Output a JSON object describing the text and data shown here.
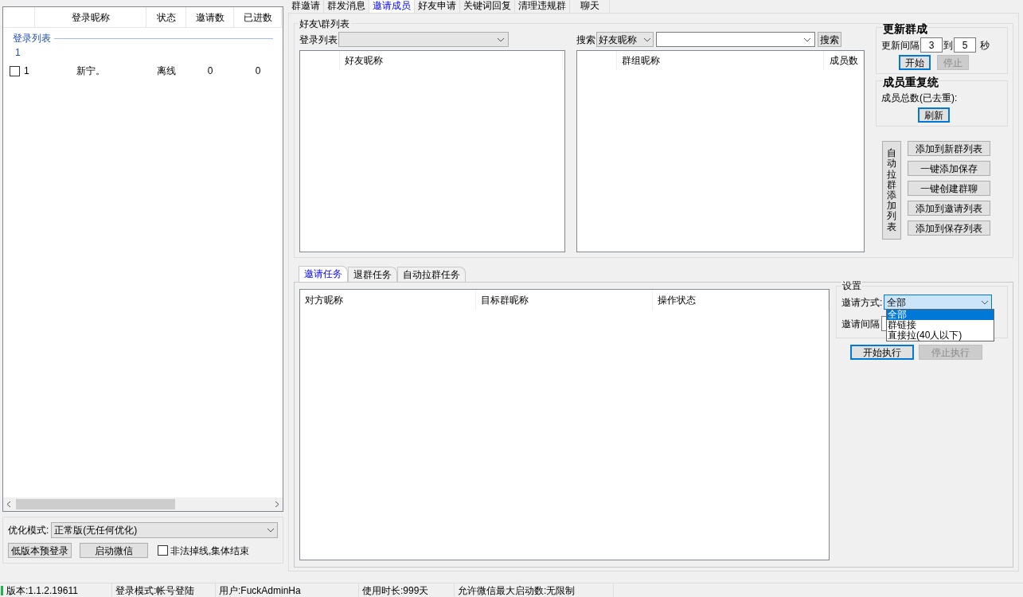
{
  "left_panel": {
    "columns": [
      "登录昵称",
      "状态",
      "邀请数",
      "已进数"
    ],
    "group": {
      "label": "登录列表",
      "count": "1"
    },
    "rows": [
      {
        "checked": false,
        "index": "1",
        "nickname": "新宁。",
        "status": "离线",
        "invites": "0",
        "joined": "0"
      }
    ],
    "optimize": {
      "label": "优化模式:",
      "value": "正常版(无任何优化)"
    },
    "buttons": [
      "低版本预登录",
      "启动微信"
    ],
    "checkbox": {
      "label": "非法掉线,集体结束",
      "checked": false
    }
  },
  "tabs": [
    {
      "label": "群邀请",
      "selected": false
    },
    {
      "label": "群发消息",
      "selected": false
    },
    {
      "label": "邀请成员",
      "selected": true
    },
    {
      "label": "好友申请",
      "selected": false
    },
    {
      "label": "关键词回复",
      "selected": false
    },
    {
      "label": "清理违规群",
      "selected": false
    },
    {
      "label": "聊天",
      "selected": false
    }
  ],
  "friend_group": {
    "title": "好友\\群列表",
    "login_label": "登录列表",
    "search_label": "搜索",
    "search_type": "好友昵称",
    "search_button": "搜索",
    "friend_columns": [
      "好友昵称"
    ],
    "group_columns": [
      "群组昵称",
      "成员数"
    ]
  },
  "update_group": {
    "title": "更新群成",
    "interval_label": "更新间隔",
    "from": "3",
    "to_label": "到",
    "to": "5",
    "unit": "秒",
    "buttons": [
      {
        "label": "开始",
        "disabled": false
      },
      {
        "label": "停止",
        "disabled": true
      }
    ]
  },
  "dedupe": {
    "title": "成员重复统",
    "total_label": "成员总数(已去重):",
    "refresh": "刷新"
  },
  "auto_pull": {
    "label": "自动拉群添加列表",
    "buttons": [
      "添加到新群列表",
      "一键添加保存",
      "一键创建群聊",
      "添加到邀请列表",
      "添加到保存列表"
    ]
  },
  "task_tabs": [
    {
      "label": "邀请任务",
      "selected": true
    },
    {
      "label": "退群任务",
      "selected": false
    },
    {
      "label": "自动拉群任务",
      "selected": false
    }
  ],
  "task_columns": [
    "对方昵称",
    "目标群昵称",
    "操作状态"
  ],
  "settings": {
    "title": "设置",
    "method_label": "邀请方式:",
    "method_value": "全部",
    "options": [
      {
        "label": "全部",
        "selected": true
      },
      {
        "label": "群链接",
        "selected": false
      },
      {
        "label": "直接拉(40人以下)",
        "selected": false
      }
    ],
    "interval_label": "邀请间隔",
    "buttons": [
      {
        "label": "开始执行",
        "disabled": false
      },
      {
        "label": "停止执行",
        "disabled": true
      }
    ]
  },
  "status_bar": [
    "版本:1.1.2.19611",
    "登录模式:帐号登陆",
    "用户:FuckAdminHa",
    "使用时长:999天",
    "允许微信最大启动数:无限制"
  ]
}
